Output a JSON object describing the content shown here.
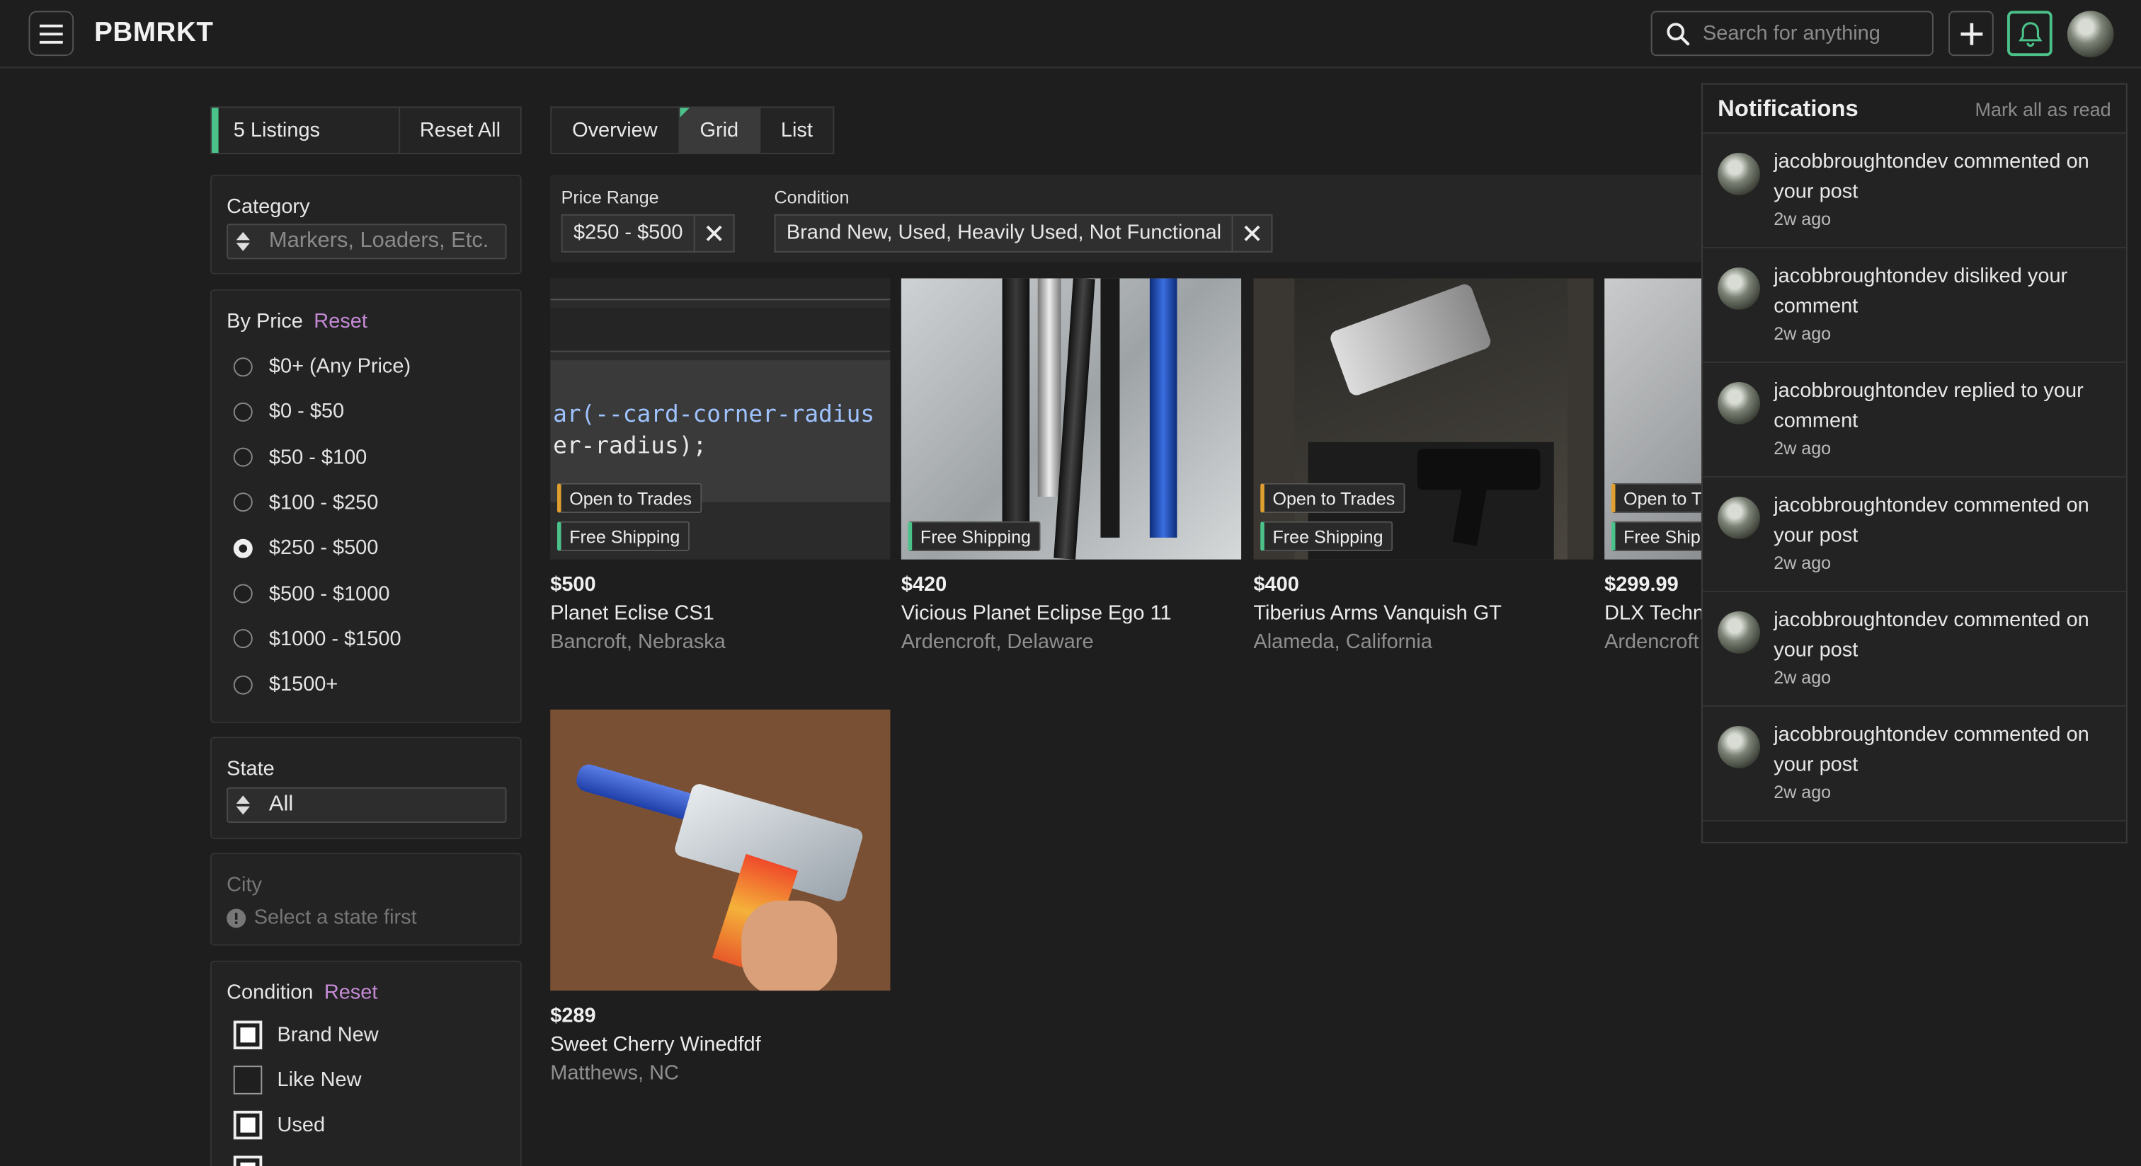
{
  "header": {
    "brand": "PBMRKT",
    "search_placeholder": "Search for anything",
    "icons": [
      "menu-icon",
      "search-icon",
      "plus-icon",
      "bell-icon",
      "avatar"
    ]
  },
  "sidebar": {
    "listings_count": "5 Listings",
    "reset_all": "Reset All",
    "category_label": "Category",
    "category_placeholder": "Markers, Loaders, Etc.",
    "price_label": "By Price",
    "price_reset": "Reset",
    "price_options": [
      "$0+ (Any Price)",
      "$0 - $50",
      "$50 - $100",
      "$100 - $250",
      "$250 - $500",
      "$500 - $1000",
      "$1000 - $1500",
      "$1500+"
    ],
    "price_selected": "$250 - $500",
    "state_label": "State",
    "state_value": "All",
    "city_label": "City",
    "city_hint": "Select a state first",
    "condition_label": "Condition",
    "condition_reset": "Reset",
    "condition_options": [
      {
        "label": "Brand New",
        "checked": true
      },
      {
        "label": "Like New",
        "checked": false
      },
      {
        "label": "Used",
        "checked": true
      }
    ]
  },
  "main": {
    "tabs": [
      "Overview",
      "Grid",
      "List"
    ],
    "active_tab": "Grid",
    "filters": {
      "price_title": "Price Range",
      "price_value": "$250 - $500",
      "condition_title": "Condition",
      "condition_value": "Brand New, Used, Heavily Used, Not Functional"
    },
    "tag_trades": "Open to Trades",
    "tag_shipping": "Free Shipping",
    "code_line1": "ar(--card-corner-radius",
    "code_line2": "er-radius);",
    "listings": [
      {
        "price": "$500",
        "title": "Planet Eclise CS1",
        "location": "Bancroft, Nebraska"
      },
      {
        "price": "$420",
        "title": "Vicious Planet Eclipse Ego 11",
        "location": "Ardencroft, Delaware"
      },
      {
        "price": "$400",
        "title": "Tiberius Arms Vanquish GT",
        "location": "Alameda, California"
      },
      {
        "price": "$299.99",
        "title": "DLX Techn",
        "location": "Ardencroft"
      },
      {
        "price": "$289",
        "title": "Sweet Cherry Winedfdf",
        "location": "Matthews, NC"
      }
    ],
    "partial_tag_trades": "Open to T",
    "partial_tag_shipping": "Free Ship"
  },
  "notifications": {
    "title": "Notifications",
    "mark_all": "Mark all as read",
    "items": [
      {
        "text": "jacobbroughtondev commented on your post",
        "ago": "2w ago"
      },
      {
        "text": "jacobbroughtondev disliked your comment",
        "ago": "2w ago"
      },
      {
        "text": "jacobbroughtondev replied to your comment",
        "ago": "2w ago"
      },
      {
        "text": "jacobbroughtondev commented on your post",
        "ago": "2w ago"
      },
      {
        "text": "jacobbroughtondev commented on your post",
        "ago": "2w ago"
      },
      {
        "text": "jacobbroughtondev commented on your post",
        "ago": "2w ago"
      }
    ]
  },
  "colors": {
    "accent": "#4bc28a",
    "link": "#c58ad6",
    "trade_tag": "#e0a030",
    "bg": "#1e1e1e"
  }
}
